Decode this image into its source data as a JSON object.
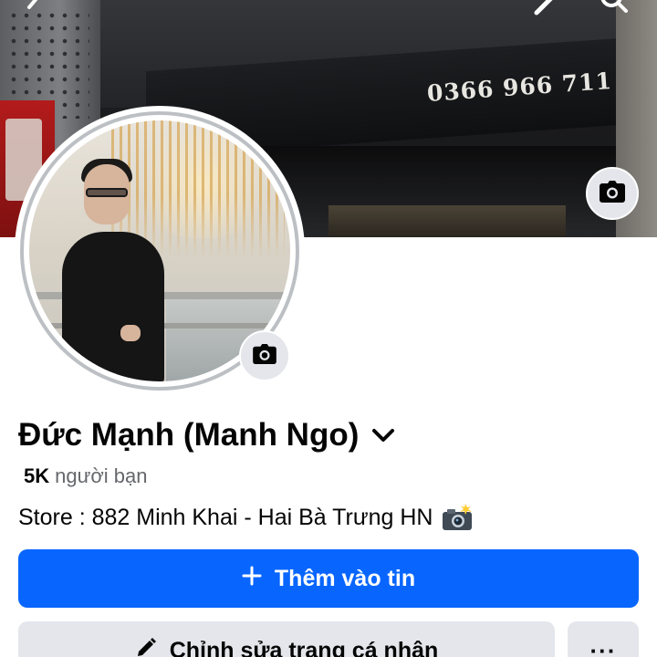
{
  "cover": {
    "phone_number": "0366 966 711"
  },
  "profile": {
    "name": "Đức Mạnh (Manh Ngo)",
    "friends_count": "5K",
    "friends_label": "người bạn",
    "bio": "Store : 882 Minh Khai - Hai Bà Trưng HN"
  },
  "actions": {
    "add_story_label": "Thêm vào tin",
    "edit_profile_label": "Chỉnh sửa trang cá nhân",
    "more_label": "···"
  },
  "icons": {
    "back": "chevron-left-icon",
    "edit": "pencil-icon",
    "search": "search-icon",
    "cover_camera": "camera-icon",
    "avatar_camera": "camera-icon",
    "name_dropdown": "chevron-down-icon",
    "bio_emoji": "camera-flash-emoji-icon",
    "add": "plus-icon",
    "edit_profile": "pencil-icon",
    "more": "more-horizontal-icon"
  },
  "colors": {
    "primary": "#0866ff",
    "secondary_button": "#e4e6eb",
    "text_primary": "#050505",
    "text_secondary": "#65676b"
  }
}
